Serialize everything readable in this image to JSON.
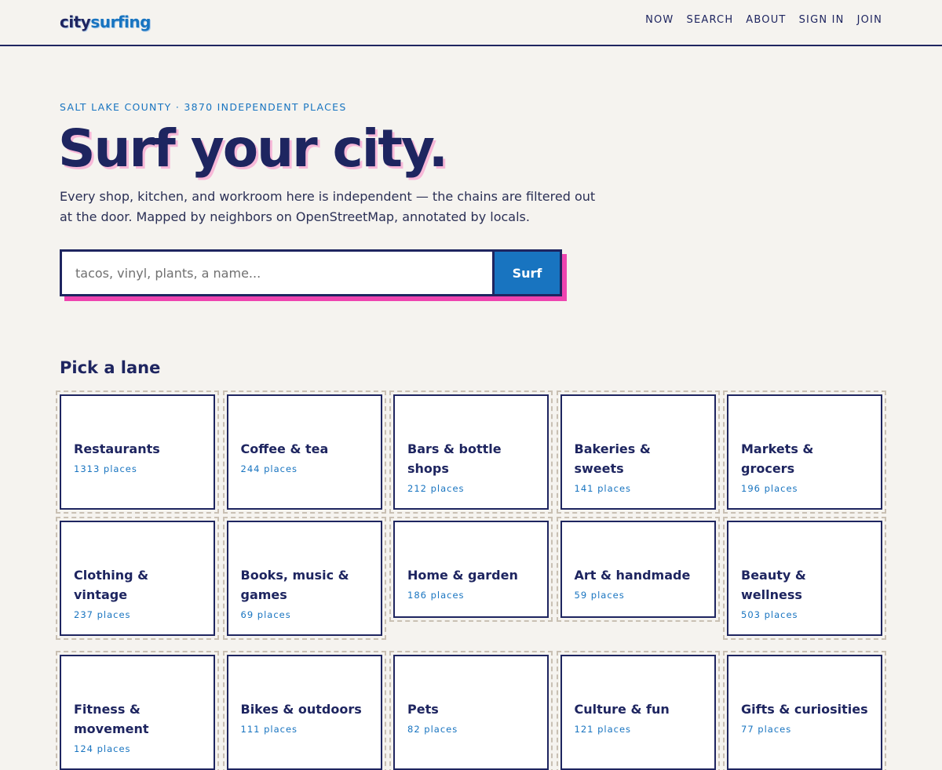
{
  "header": {
    "logo_part1": "city",
    "logo_part2": "surfing",
    "nav": [
      "NOW",
      "SEARCH",
      "ABOUT",
      "SIGN IN",
      "JOIN"
    ]
  },
  "hero": {
    "eyebrow": "SALT LAKE COUNTY · 3870 INDEPENDENT PLACES",
    "title": "Surf your city.",
    "lede": "Every shop, kitchen, and workroom here is independent — the chains are filtered out at the door. Mapped by neighbors on OpenStreetMap, annotated by locals."
  },
  "search": {
    "placeholder": "tacos, vinyl, plants, a name...",
    "button_label": "Surf"
  },
  "lanes": {
    "title": "Pick a lane",
    "items": [
      {
        "name": "Restaurants",
        "count": "1313 places"
      },
      {
        "name": "Coffee & tea",
        "count": "244 places"
      },
      {
        "name": "Bars & bottle shops",
        "count": "212 places"
      },
      {
        "name": "Bakeries & sweets",
        "count": "141 places"
      },
      {
        "name": "Markets & grocers",
        "count": "196 places"
      },
      {
        "name": "Clothing & vintage",
        "count": "237 places"
      },
      {
        "name": "Books, music & games",
        "count": "69 places"
      },
      {
        "name": "Home & garden",
        "count": "186 places"
      },
      {
        "name": "Art & handmade",
        "count": "59 places"
      },
      {
        "name": "Beauty & wellness",
        "count": "503 places"
      },
      {
        "name": "Fitness & movement",
        "count": "124 places"
      },
      {
        "name": "Bikes & outdoors",
        "count": "111 places"
      },
      {
        "name": "Pets",
        "count": "82 places"
      },
      {
        "name": "Culture & fun",
        "count": "121 places"
      },
      {
        "name": "Gifts & curiosities",
        "count": "77 places"
      }
    ]
  }
}
